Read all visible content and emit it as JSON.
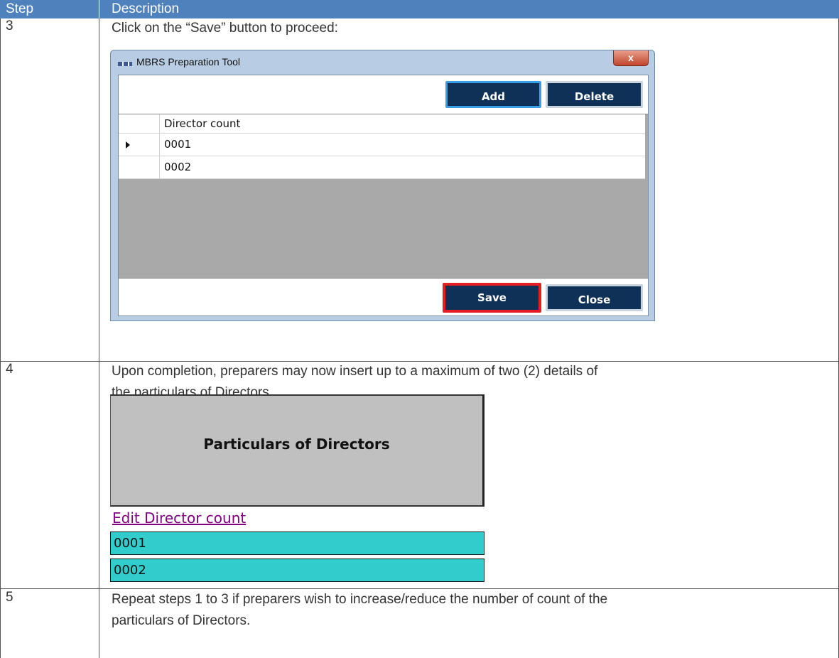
{
  "table": {
    "header": {
      "step": "Step",
      "description": "Description"
    },
    "rows": [
      {
        "step": "3",
        "text": "Click on the “Save” button to proceed:"
      },
      {
        "step": "4",
        "text_line1": "Upon completion, preparers may now insert up to a maximum of two (2) details of",
        "text_line2": "the particulars of Directors."
      },
      {
        "step": "5",
        "text_line1": "Repeat steps 1 to 3 if preparers wish to increase/reduce the number of count of the",
        "text_line2": "particulars of Directors."
      }
    ]
  },
  "dialog": {
    "title": "MBRS Preparation Tool",
    "close_glyph": "x",
    "add_label": "Add",
    "delete_label": "Delete",
    "column_header": "Director count",
    "rows": [
      "0001",
      "0002"
    ],
    "save_label": "Save",
    "close_label": "Close"
  },
  "particulars": {
    "title": "Particulars of Directors",
    "edit_link": "Edit Director count",
    "entries": [
      "0001",
      "0002"
    ]
  },
  "colors": {
    "header_bg": "#4f81bd",
    "button_bg": "#0f3158",
    "highlight": "#e51d25",
    "cyan_cells": "#33cccc",
    "link": "#800080"
  }
}
